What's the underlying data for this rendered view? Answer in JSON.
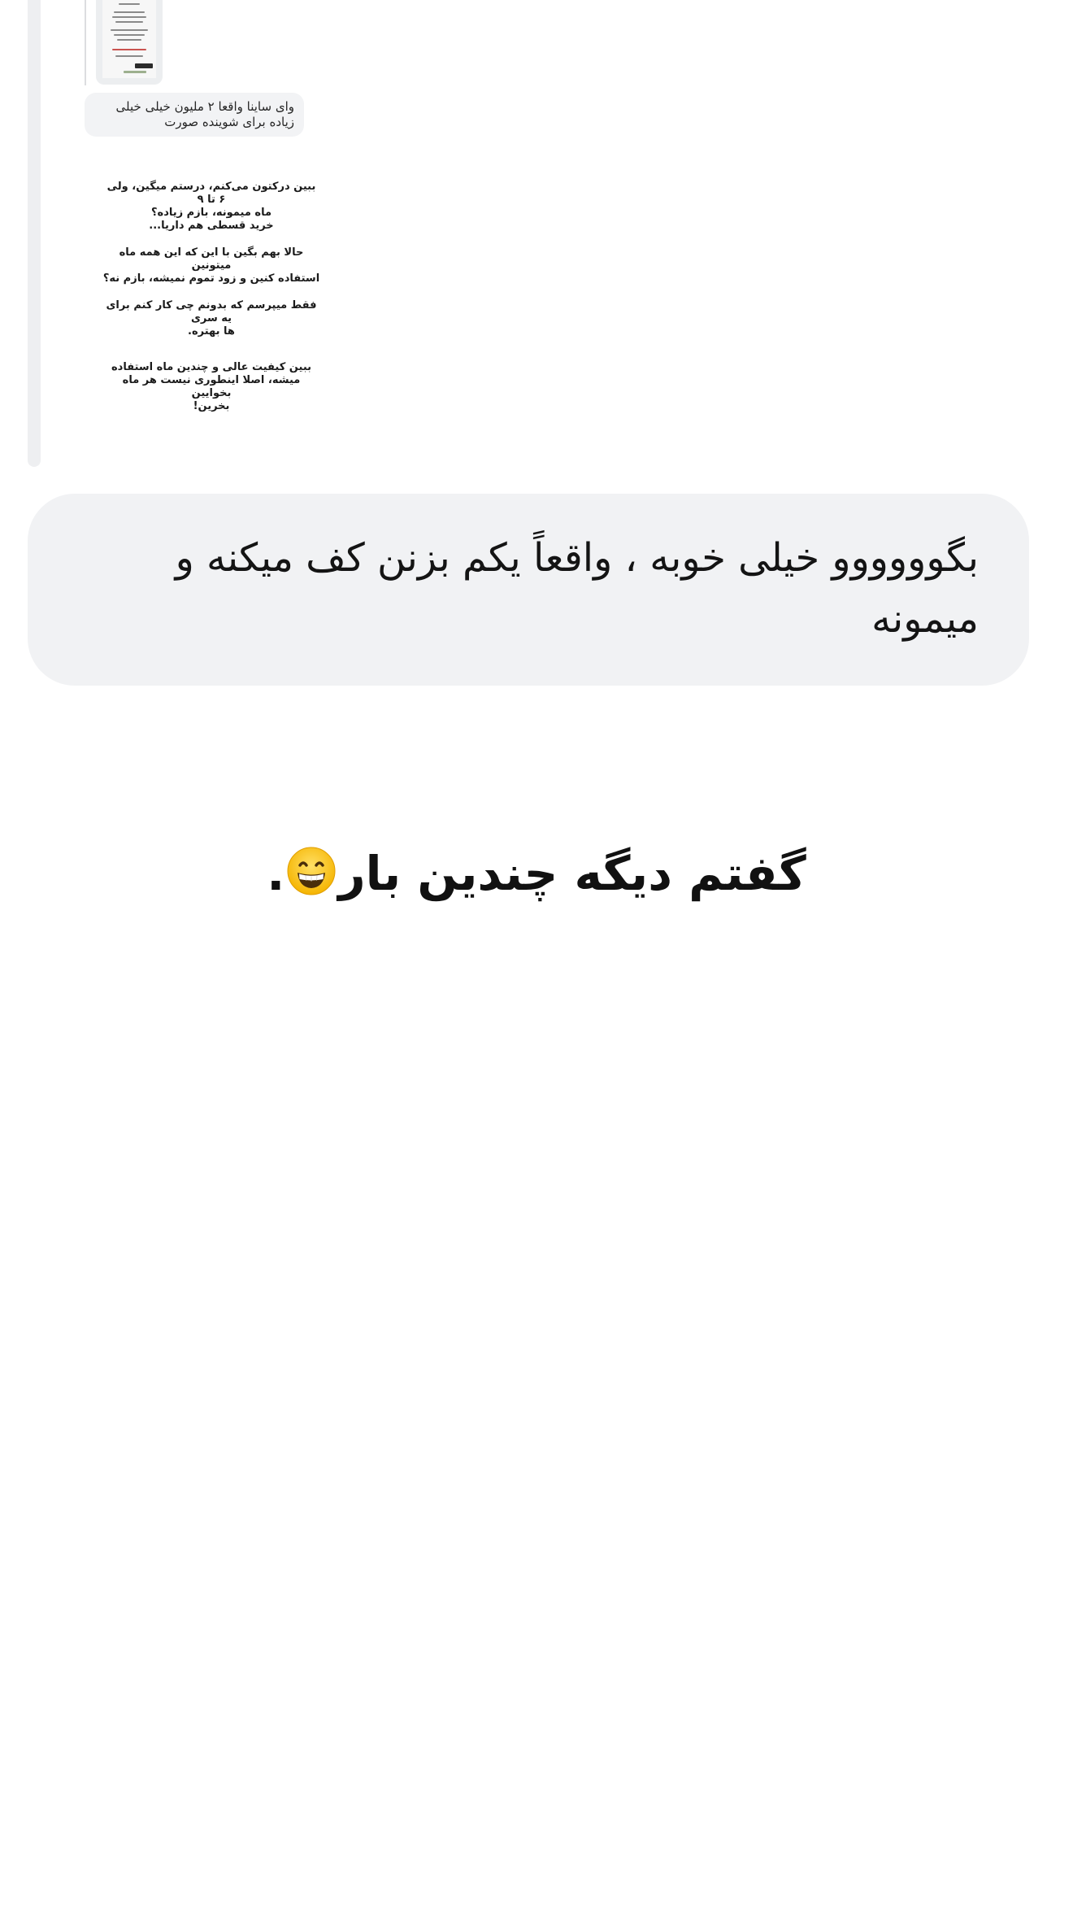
{
  "thread": {
    "quoted_caption": "وای ساینا واقعا ۲ ملیون خیلی خیلی زیاده برای شوینده صورت",
    "story_lines": [
      "ببین درکتون می‌کنم، درستم میگین، ولی ۶ تا ۹\nماه میمونه، بازم زیاده؟\nخرید قسطی هم داریا...",
      "حالا بهم بگین با این که این همه ماه میتونین\nاستفاده کنین و زود تموم نمیشه، بازم نه؟",
      "فقط میپرسم که بدونم چی کار کنم برای یه سری\nها بهتره.",
      "ببین کیفیت عالی و چندین ماه استفاده\nمیشه، اصلا اینطوری نیست هر ماه بخوایین\nبخرین!"
    ]
  },
  "message": {
    "text": "بگوووووو خیلی خوبه ، واقعاً یکم بزنن کف میکنه و میمونه"
  },
  "caption": {
    "text": "گفتم دیگه چندین بار",
    "suffix": ".",
    "emoji_icon": "grinning-face-with-smiling-eyes-icon"
  },
  "colors": {
    "bubble_bg": "#f1f2f4",
    "thread_bar": "#eeeff1",
    "text": "#111111"
  }
}
